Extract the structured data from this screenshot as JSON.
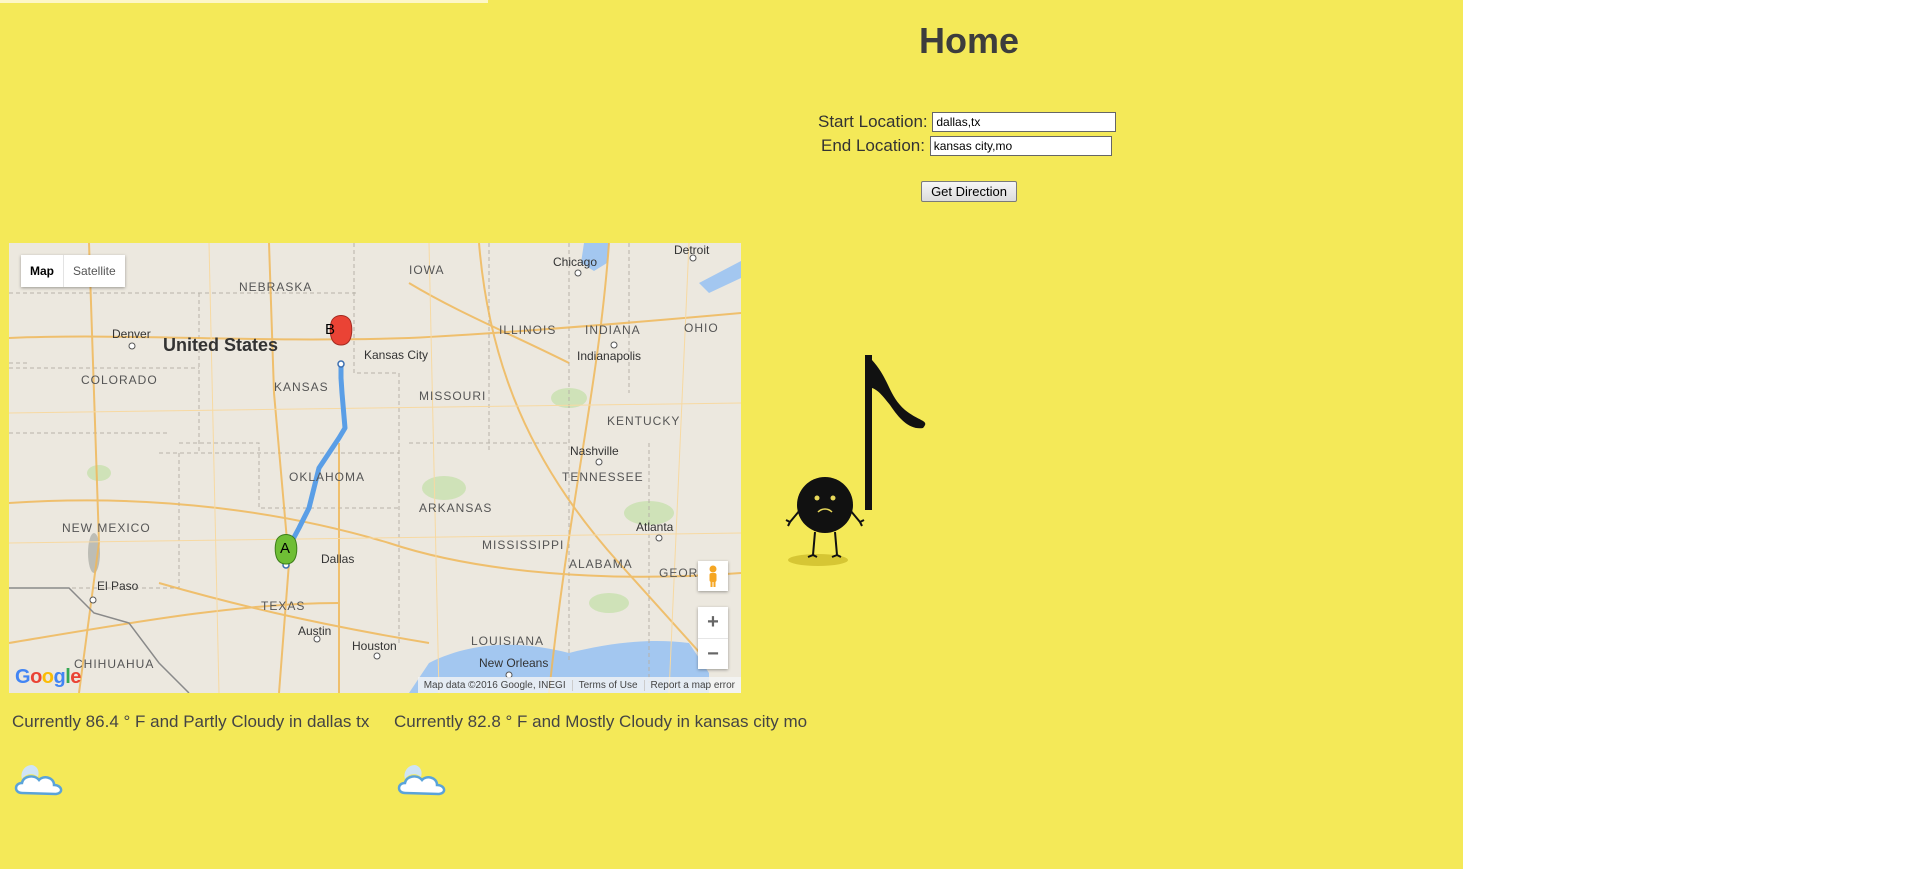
{
  "title": "Home",
  "form": {
    "start_label": "Start Location:",
    "start_value": "dallas,tx",
    "end_label": "End Location:",
    "end_value": "kansas city,mo",
    "submit_label": "Get Direction"
  },
  "map": {
    "type_buttons": {
      "map": "Map",
      "satellite": "Satellite"
    },
    "selected_type": "Map",
    "country_label": "United States",
    "state_labels": [
      "NEBRASKA",
      "IOWA",
      "ILLINOIS",
      "INDIANA",
      "OHIO",
      "COLORADO",
      "KANSAS",
      "MISSOURI",
      "KENTUCKY",
      "OKLAHOMA",
      "TENNESSEE",
      "ARKANSAS",
      "NEW MEXICO",
      "MISSISSIPPI",
      "ALABAMA",
      "TEXAS",
      "LOUISIANA",
      "CHIHUAHUA",
      "GEORG"
    ],
    "city_labels": [
      "Denver",
      "Chicago",
      "Detroit",
      "Indianapolis",
      "Kansas City",
      "Nashville",
      "Atlanta",
      "El Paso",
      "Dallas",
      "Austin",
      "Houston",
      "New Orleans"
    ],
    "marker_a": "A",
    "marker_b": "B",
    "zoom_in": "+",
    "zoom_out": "−",
    "logo": "Google",
    "attribution": [
      "Map data ©2016 Google, INEGI",
      "Terms of Use",
      "Report a map error"
    ],
    "route_color": "#5a9ee6"
  },
  "weather": [
    {
      "text": "Currently 86.4 ° F and Partly Cloudy in dallas tx",
      "icon": "partly-cloudy-night-icon"
    },
    {
      "text": "Currently 82.8 ° F and Mostly Cloudy in kansas city mo",
      "icon": "partly-cloudy-night-icon"
    }
  ],
  "colors": {
    "page_background": "#f4e958",
    "marker_a": "#6fbe35",
    "marker_b": "#ea4335"
  }
}
